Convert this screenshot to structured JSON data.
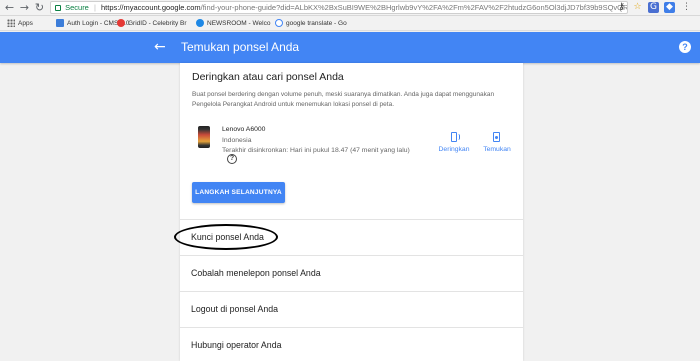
{
  "browser": {
    "secure_label": "Secure",
    "url_host": "https://myaccount.google.com",
    "url_rest": "/find-your-phone-guide?did=ALbKX%2BxSuBI9WE%2BHgrlwb9vY%2FA%2Fm%2FAV%2F2htudzG6on5Ol3djJD7bf39b9SQvQREz..."
  },
  "bookmarks": [
    {
      "label": "Apps",
      "icon": "apps-grid-icon"
    },
    {
      "label": "Auth Login - CMS-5.0",
      "icon": "doc-icon",
      "color": "#3c7dd9"
    },
    {
      "label": "GridID - Celebrity Br",
      "icon": "gridid-icon",
      "color": "#e53935"
    },
    {
      "label": "NEWSROOM - Welco",
      "icon": "newsroom-icon",
      "color": "#1e88e5"
    },
    {
      "label": "google translate - Go",
      "icon": "google-icon",
      "color": "#4285f4"
    }
  ],
  "header": {
    "title": "Temukan ponsel Anda",
    "back_icon": "arrow-left-icon",
    "help_icon": "help-icon",
    "color": "#4285f4"
  },
  "ring_section": {
    "title": "Deringkan atau cari ponsel Anda",
    "description": "Buat ponsel berdering dengan volume penuh, meski suaranya dimatikan. Anda juga dapat menggunakan Pengelola Perangkat Android untuk menemukan lokasi ponsel di peta.",
    "device": {
      "name": "Lenovo A6000",
      "country": "Indonesia",
      "sync_status": "Terakhir disinkronkan: Hari ini pukul 18.47 (47 menit yang lalu)"
    },
    "actions": {
      "ring": "Deringkan",
      "find": "Temukan"
    },
    "next_button": "LANGKAH SELANJUTNYA"
  },
  "options": [
    "Kunci ponsel Anda",
    "Cobalah menelepon ponsel Anda",
    "Logout di ponsel Anda",
    "Hubungi operator Anda"
  ]
}
